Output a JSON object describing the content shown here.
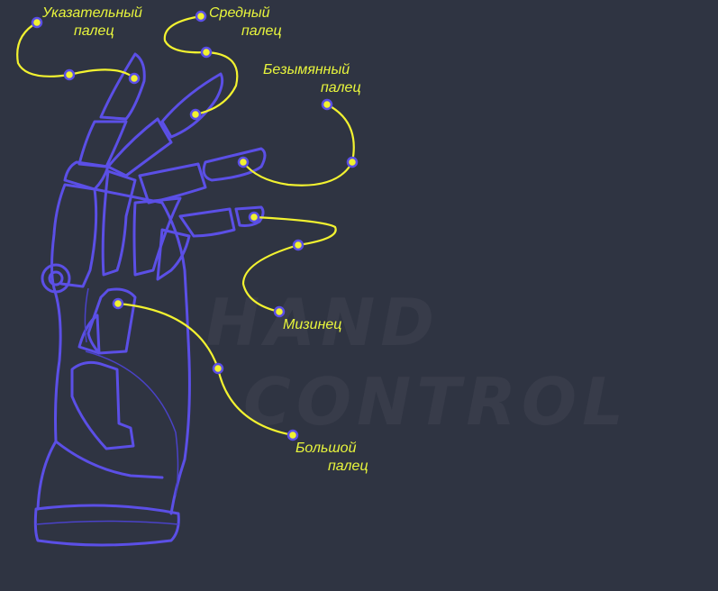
{
  "background_text": {
    "line1": "HAND",
    "line2": "CONTROL"
  },
  "labels": {
    "index": {
      "line1": "Указательный",
      "line2": "палец"
    },
    "middle": {
      "line1": "Средный",
      "line2": "палец"
    },
    "ring": {
      "line1": "Безымянный",
      "line2": "палец"
    },
    "pinky": {
      "line1": "Мизинец"
    },
    "thumb": {
      "line1": "Большой",
      "line2": "палец"
    }
  },
  "colors": {
    "background": "#2f3442",
    "hand_outline": "#5b4fe6",
    "callout_line": "#f2f230",
    "marker_fill": "#f2f230",
    "marker_ring": "#5b4fe6",
    "label_text": "#e8f53c",
    "watermark": "#383c4a"
  }
}
